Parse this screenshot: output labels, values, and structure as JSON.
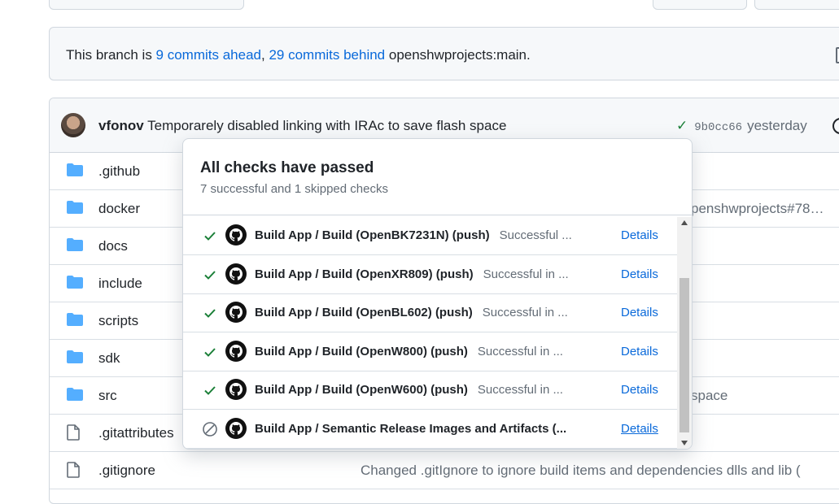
{
  "banner": {
    "prefix": "This branch is ",
    "ahead": "9 commits ahead",
    "sep": ", ",
    "behind": "29 commits behind",
    "suffix": " openshwprojects:main."
  },
  "commit": {
    "author": "vfonov",
    "message": "Temporarely disabled linking with IRAc to save flash space",
    "status_icon": "check-icon",
    "sha": "9b0cc66",
    "time": "yesterday"
  },
  "files": [
    {
      "type": "folder",
      "name": ".github",
      "message": ""
    },
    {
      "type": "folder",
      "name": "docker",
      "message": "...",
      "message_link": "penshwprojects#78…"
    },
    {
      "type": "folder",
      "name": "docs",
      "message": ""
    },
    {
      "type": "folder",
      "name": "include",
      "message": ""
    },
    {
      "type": "folder",
      "name": "scripts",
      "message": ""
    },
    {
      "type": "folder",
      "name": "sdk",
      "message": ""
    },
    {
      "type": "folder",
      "name": "src",
      "message": "space"
    },
    {
      "type": "file",
      "name": ".gitattributes",
      "message": ""
    },
    {
      "type": "file",
      "name": ".gitignore",
      "message": "Changed .gitIgnore to ignore build items and dependencies dlls and lib ("
    }
  ],
  "popover": {
    "title": "All checks have passed",
    "subtitle": "7 successful and 1 skipped checks",
    "checks": [
      {
        "status": "success",
        "name": "Build App / Build (OpenBK7231N) (push)",
        "status_text": "Successful ...",
        "details": "Details"
      },
      {
        "status": "success",
        "name": "Build App / Build (OpenXR809) (push)",
        "status_text": "Successful in ...",
        "details": "Details"
      },
      {
        "status": "success",
        "name": "Build App / Build (OpenBL602) (push)",
        "status_text": "Successful in ...",
        "details": "Details"
      },
      {
        "status": "success",
        "name": "Build App / Build (OpenW800) (push)",
        "status_text": "Successful in ...",
        "details": "Details"
      },
      {
        "status": "success",
        "name": "Build App / Build (OpenW600) (push)",
        "status_text": "Successful in ...",
        "details": "Details"
      },
      {
        "status": "skipped",
        "name": "Build App / Semantic Release Images and Artifacts (...",
        "status_text": "",
        "details": "Details"
      }
    ]
  },
  "colors": {
    "success": "#1a7f37",
    "link": "#0969da",
    "folder": "#54aeff",
    "muted": "#636c76"
  }
}
